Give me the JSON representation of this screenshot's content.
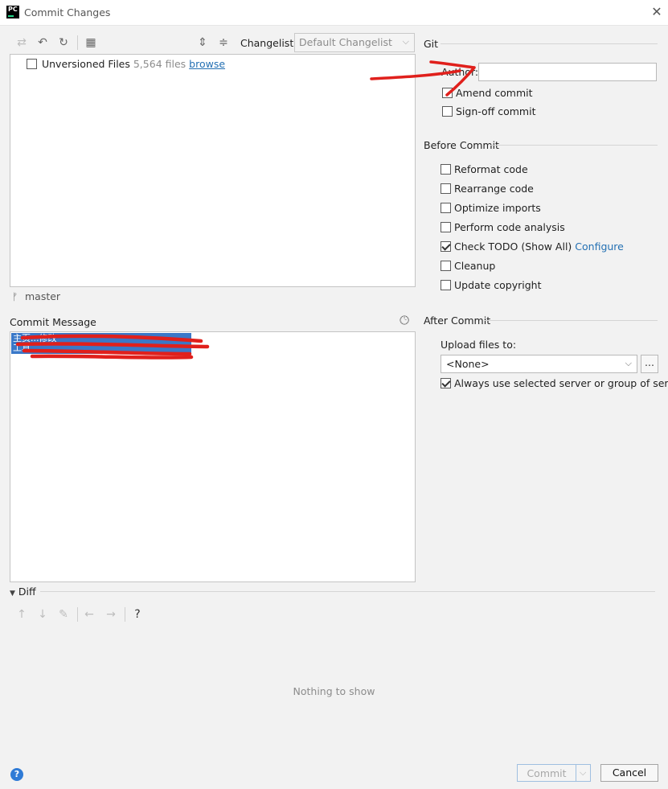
{
  "window": {
    "title": "Commit Changes",
    "app_icon_text": "PC"
  },
  "toolbar": {
    "changelist_label": "Changelist:",
    "changelist_value": "Default Changelist"
  },
  "changes": {
    "row_label": "Unversioned Files",
    "file_count": "5,564 files",
    "browse_link": "browse"
  },
  "branch": {
    "name": "master"
  },
  "commit_message": {
    "label": "Commit Message",
    "selected_line_1": "主页...修改",
    "selected_line_2": "工具..."
  },
  "git": {
    "section_title": "Git",
    "author_label": "Author:",
    "author_value": "",
    "amend_commit": "Amend commit",
    "signoff_commit": "Sign-off commit"
  },
  "before_commit": {
    "section_title": "Before Commit",
    "options": [
      {
        "label": "Reformat code",
        "checked": false
      },
      {
        "label": "Rearrange code",
        "checked": false
      },
      {
        "label": "Optimize imports",
        "checked": false
      },
      {
        "label": "Perform code analysis",
        "checked": false
      },
      {
        "label": "Check TODO (Show All)",
        "checked": true
      },
      {
        "label": "Cleanup",
        "checked": false
      },
      {
        "label": "Update copyright",
        "checked": false
      }
    ],
    "configure_link": "Configure"
  },
  "after_commit": {
    "section_title": "After Commit",
    "upload_label": "Upload files to:",
    "upload_value": "<None>",
    "browse_button": "...",
    "always_use_label": "Always use selected server or group of servers"
  },
  "diff": {
    "section_title": "Diff",
    "help_icon_text": "?",
    "empty_text": "Nothing to show"
  },
  "buttons": {
    "help": "?",
    "commit": "Commit",
    "cancel": "Cancel"
  },
  "colors": {
    "accent": "#2470b3",
    "selection": "#3a78c8",
    "annotation_red": "#e0201c"
  }
}
